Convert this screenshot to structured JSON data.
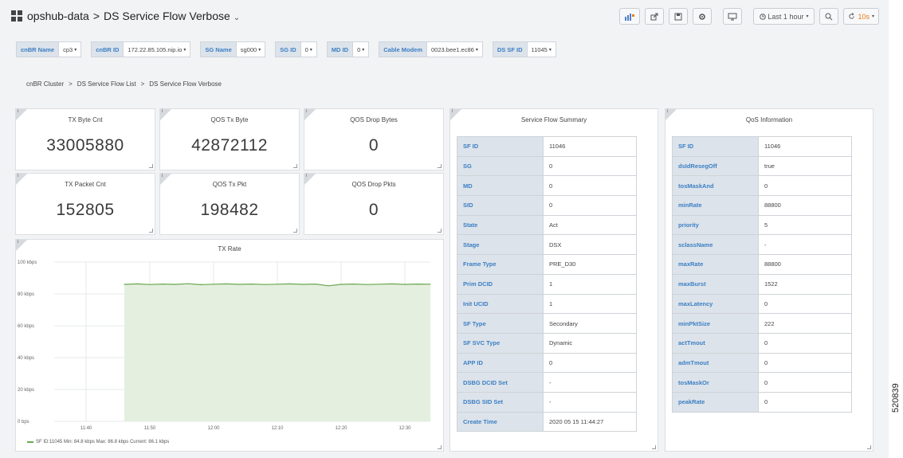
{
  "header": {
    "folder": "opshub-data",
    "sep": ">",
    "dashboard_title": "DS Service Flow Verbose",
    "caret": "⌄",
    "time_range": "Last 1 hour",
    "refresh_value": "10s"
  },
  "variables": [
    {
      "label": "cnBR Name",
      "value": "cp3"
    },
    {
      "label": "cnBR ID",
      "value": "172.22.85.105.nip.io"
    },
    {
      "label": "SG Name",
      "value": "sg000"
    },
    {
      "label": "SG ID",
      "value": "0"
    },
    {
      "label": "MD ID",
      "value": "0"
    },
    {
      "label": "Cable Modem",
      "value": "0023.bee1.ec86"
    },
    {
      "label": "DS SF ID",
      "value": "11045"
    }
  ],
  "breadcrumb": [
    "cnBR Cluster",
    "DS Service Flow List",
    "DS Service Flow Verbose"
  ],
  "breadcrumb_sep": ">",
  "stats": {
    "tx_byte": {
      "title": "TX Byte Cnt",
      "value": "33005880"
    },
    "qos_tx_byte": {
      "title": "QOS Tx Byte",
      "value": "42872112"
    },
    "qos_drop_bytes": {
      "title": "QOS Drop Bytes",
      "value": "0"
    },
    "tx_packet": {
      "title": "TX Packet Cnt",
      "value": "152805"
    },
    "qos_tx_pkt": {
      "title": "QOS Tx Pkt",
      "value": "198482"
    },
    "qos_drop_pkts": {
      "title": "QOS Drop Pkts",
      "value": "0"
    }
  },
  "service_flow_summary": {
    "title": "Service Flow Summary",
    "rows": [
      [
        "SF ID",
        "11046"
      ],
      [
        "SG",
        "0"
      ],
      [
        "MD",
        "0"
      ],
      [
        "SID",
        "0"
      ],
      [
        "State",
        "Act"
      ],
      [
        "Stage",
        "DSX"
      ],
      [
        "Frame Type",
        "PRE_D30"
      ],
      [
        "Prim DCID",
        "1"
      ],
      [
        "Init UCID",
        "1"
      ],
      [
        "SF Type",
        "Secondary"
      ],
      [
        "SF SVC Type",
        "Dynamic"
      ],
      [
        "APP ID",
        "0"
      ],
      [
        "DSBG DCID Set",
        "-"
      ],
      [
        "DSBG SID Set",
        "-"
      ],
      [
        "Create Time",
        "2020 05 15 11:44:27"
      ]
    ]
  },
  "qos_information": {
    "title": "QoS Information",
    "rows": [
      [
        "SF ID",
        "11046"
      ],
      [
        "dsIdResegOff",
        "true"
      ],
      [
        "tosMaskAnd",
        "0"
      ],
      [
        "minRate",
        "88800"
      ],
      [
        "priority",
        "5"
      ],
      [
        "sclassName",
        "-"
      ],
      [
        "maxRate",
        "88800"
      ],
      [
        "maxBurst",
        "1522"
      ],
      [
        "maxLatency",
        "0"
      ],
      [
        "minPktSize",
        "222"
      ],
      [
        "actTmout",
        "0"
      ],
      [
        "admTmout",
        "0"
      ],
      [
        "tosMaskOr",
        "0"
      ],
      [
        "peakRate",
        "0"
      ]
    ]
  },
  "chart_data": {
    "type": "area",
    "title": "TX Rate",
    "y_ticks": [
      "0 bps",
      "20 kbps",
      "40 kbps",
      "60 kbps",
      "80 kbps",
      "100 kbps"
    ],
    "ylim": [
      0,
      100
    ],
    "x_ticks": [
      "11:40",
      "11:50",
      "12:00",
      "12:10",
      "12:20",
      "12:30"
    ],
    "x_tick_minutes": [
      40,
      50,
      60,
      70,
      80,
      90
    ],
    "xlim_minutes": [
      35,
      94
    ],
    "series": [
      {
        "name": "SF ID:11045",
        "color": "#6aa84f",
        "x_minutes": [
          46,
          48,
          50,
          52,
          54,
          56,
          58,
          60,
          62,
          64,
          66,
          68,
          70,
          72,
          74,
          76,
          78,
          80,
          82,
          84,
          86,
          88,
          90,
          92,
          94
        ],
        "values": [
          86.0,
          86.3,
          85.9,
          86.2,
          86.0,
          86.4,
          85.8,
          86.1,
          86.3,
          86.0,
          86.2,
          85.9,
          86.1,
          86.3,
          86.0,
          86.2,
          85.1,
          86.0,
          86.2,
          85.9,
          86.1,
          86.3,
          86.0,
          86.2,
          86.1
        ]
      }
    ],
    "legend_text": "SF ID:11045  Min: 84.8 kbps  Max: 86.8 kbps  Current: 86.1 kbps"
  },
  "side_number": "520839"
}
